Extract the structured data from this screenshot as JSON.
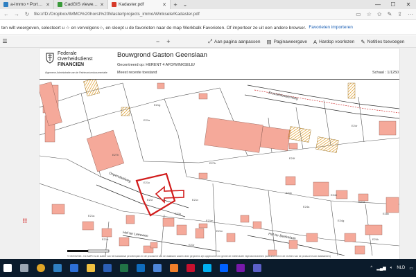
{
  "browser": {
    "tabs": [
      {
        "label": "a-Immo • Portefeuille • C",
        "color": "#2f7fc1",
        "active": false
      },
      {
        "label": "CadGIS viewer web",
        "color": "#3a9a3a",
        "active": false
      },
      {
        "label": "Kadaster.pdf",
        "color": "#d63a2a",
        "active": true
      }
    ],
    "new_tab": "+",
    "url": "file:///D:/Dropbox/IMMO%20horst%20Master/projects_immo/Winksele/Kadaster.pdf",
    "favorites_bar_text": "ten wilt weergeven, selecteert u ☆ en vervolgens☆, en sleept u de favorieten naar de map Werkbalk Favorieten. Of importeer ze uit een andere browser.",
    "favorites_import_link": "Favorieten importeren"
  },
  "pdf_toolbar": {
    "zoom_out": "−",
    "zoom_in": "+",
    "fit_page": "Aan pagina aanpassen",
    "page_view": "Paginaweergave",
    "read_aloud": "Hardop voorlezen",
    "add_notes": "Notities toevoegen"
  },
  "document": {
    "org_line1": "Federale",
    "org_line2": "Overheidsdienst",
    "org_line3": "FINANCIEN",
    "org_sub": "Algemene Administratie van de Patrimoniumdocumentatie",
    "title": "Bouwgrond Gaston Geenslaan",
    "generated": "Gecentreerd op: HERENT 4 AFD/WINKSELE/",
    "state": "Meest recente toestand",
    "scale": "Schaal : 1/1250",
    "footnote": "© 03/03/2018 - De AAPD is de auteur van het kadastraal percelenplan en de producent van de databank waarin deze gegevens zijn opgenomen en geniet de intellectuele eigendomsrechten (auteursrecht en de rechten van de producent van databanken)"
  },
  "map": {
    "streets": [
      "Brusselsesteenweg",
      "Dopendaelweg",
      "Hof ter Leeuwen",
      "Hof ter Beekelaan"
    ],
    "parcels": [
      "E21g",
      "E21s",
      "E24r",
      "E24f",
      "E27b",
      "E27h",
      "E21c",
      "E21t",
      "E21v",
      "E21k",
      "E21m",
      "E21n",
      "E21r",
      "E24c",
      "E24e",
      "E24d",
      "E24g",
      "E28c",
      "E24a",
      "E21a",
      "E21b",
      "E24k"
    ],
    "highlight_color": "#d11b1b",
    "building_color": "#f5a99a"
  },
  "side_marks": "!!",
  "taskbar": {
    "apps": [
      {
        "name": "start",
        "color": "#ffffff"
      },
      {
        "name": "task-view",
        "color": "#9aa5b1"
      },
      {
        "name": "chrome",
        "color": "#e0a526"
      },
      {
        "name": "edge",
        "color": "#2f7fc1"
      },
      {
        "name": "mail",
        "color": "#2d6fd6"
      },
      {
        "name": "explorer",
        "color": "#f0c040"
      },
      {
        "name": "word",
        "color": "#2b5fb6"
      },
      {
        "name": "excel",
        "color": "#217346"
      },
      {
        "name": "outlook",
        "color": "#0f6cbd"
      },
      {
        "name": "store",
        "color": "#4d86d9"
      },
      {
        "name": "photos",
        "color": "#f07f2a"
      },
      {
        "name": "acrobat",
        "color": "#c8102e"
      },
      {
        "name": "skype",
        "color": "#00aff0"
      },
      {
        "name": "dropbox",
        "color": "#0061ff"
      },
      {
        "name": "onenote",
        "color": "#7719aa"
      },
      {
        "name": "teams",
        "color": "#5b5fc7"
      }
    ],
    "lang": "NLD"
  }
}
